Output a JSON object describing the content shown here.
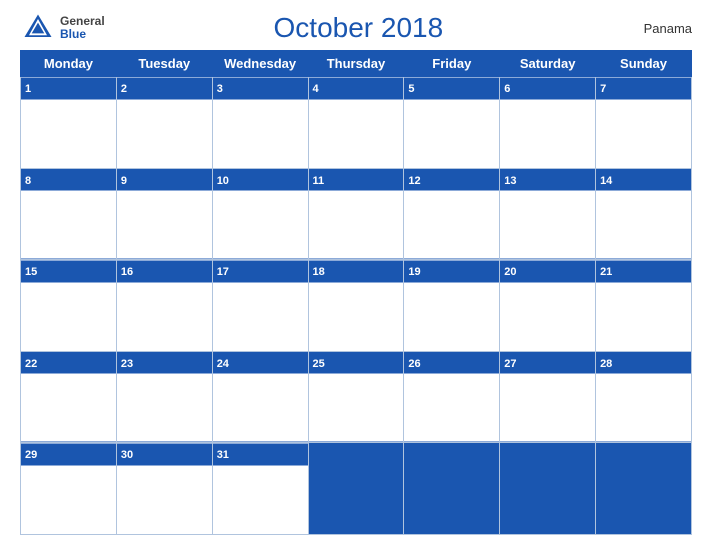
{
  "header": {
    "logo_general": "General",
    "logo_blue": "Blue",
    "title": "October 2018",
    "country": "Panama"
  },
  "days": [
    "Monday",
    "Tuesday",
    "Wednesday",
    "Thursday",
    "Friday",
    "Saturday",
    "Sunday"
  ],
  "weeks": [
    [
      1,
      2,
      3,
      4,
      5,
      6,
      7
    ],
    [
      8,
      9,
      10,
      11,
      12,
      13,
      14
    ],
    [
      15,
      16,
      17,
      18,
      19,
      20,
      21
    ],
    [
      22,
      23,
      24,
      25,
      26,
      27,
      28
    ],
    [
      29,
      30,
      31,
      null,
      null,
      null,
      null
    ]
  ]
}
